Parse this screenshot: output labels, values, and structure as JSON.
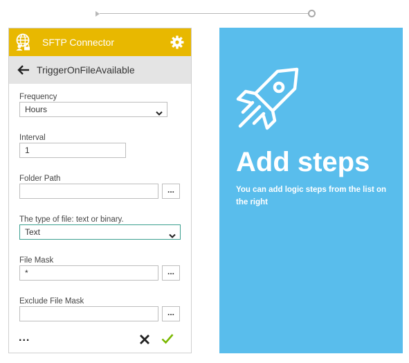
{
  "connector": {
    "title": "SFTP Connector",
    "header_color": "#e8b800",
    "app_icon": "globe-user-icon",
    "settings_icon": "gear-icon"
  },
  "trigger": {
    "back_icon": "arrow-left-icon",
    "name": "TriggerOnFileAvailable"
  },
  "fields": {
    "frequency": {
      "label": "Frequency",
      "value": "Hours"
    },
    "interval": {
      "label": "Interval",
      "value": "1"
    },
    "folder_path": {
      "label": "Folder Path",
      "value": "",
      "browse_label": "..."
    },
    "file_type": {
      "label": "The type of file: text or binary.",
      "value": "Text"
    },
    "file_mask": {
      "label": "File Mask",
      "value": "*",
      "browse_label": "..."
    },
    "exclude_file_mask": {
      "label": "Exclude File Mask",
      "value": "",
      "browse_label": "..."
    }
  },
  "footer": {
    "more_label": "...",
    "cancel_icon": "close-icon",
    "confirm_icon": "checkmark-icon"
  },
  "add_steps": {
    "icon": "rocket-icon",
    "heading": "Add steps",
    "description": "You can add logic steps from the list on the right",
    "background": "#59bdec"
  }
}
